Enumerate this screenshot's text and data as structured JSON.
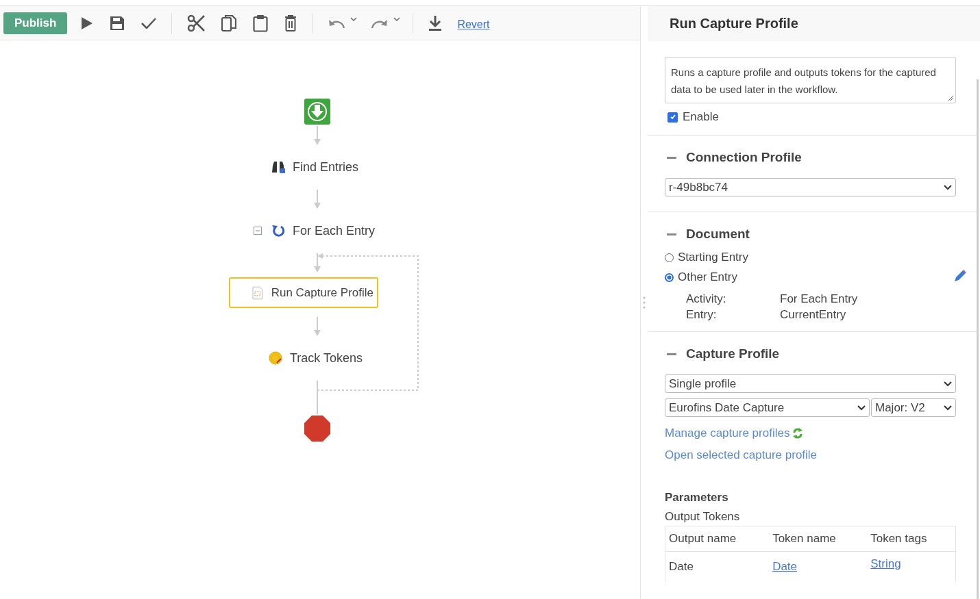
{
  "toolbar": {
    "publish": "Publish",
    "revert": "Revert"
  },
  "workflow": [
    {
      "kind": "start"
    },
    {
      "kind": "find",
      "label": "Find Entries",
      "selected": false
    },
    {
      "kind": "loop",
      "label": "For Each Entry",
      "selected": false,
      "expanded": true
    },
    {
      "kind": "capture",
      "label": "Run Capture Profile",
      "selected": true
    },
    {
      "kind": "tokens",
      "label": "Track Tokens",
      "selected": false
    },
    {
      "kind": "end"
    }
  ],
  "panel": {
    "title": "Run Capture Profile",
    "description": "Runs a capture profile and outputs tokens for the captured data to be used later in the workflow.",
    "enable": {
      "label": "Enable",
      "checked": true
    },
    "connection": {
      "title": "Connection Profile",
      "expanded": true,
      "value": "r-49b8bc74"
    },
    "document": {
      "title": "Document",
      "expanded": true,
      "options": [
        {
          "label": "Starting Entry",
          "selected": false
        },
        {
          "label": "Other Entry",
          "selected": true
        }
      ],
      "details": [
        {
          "label": "Activity:",
          "value": "For Each Entry"
        },
        {
          "label": "Entry:",
          "value": "CurrentEntry"
        }
      ]
    },
    "capture": {
      "title": "Capture Profile",
      "expanded": true,
      "mode": "Single profile",
      "profile": "Eurofins Date Capture",
      "version": "Major: V2",
      "manage_link": "Manage capture profiles",
      "open_link": "Open selected capture profile"
    },
    "parameters": {
      "title": "Parameters",
      "subtitle": "Output Tokens",
      "columns": [
        "Output name",
        "Token name",
        "Token tags"
      ],
      "rows": [
        {
          "output": "Date",
          "token": "Date",
          "tags": "String"
        }
      ]
    }
  }
}
